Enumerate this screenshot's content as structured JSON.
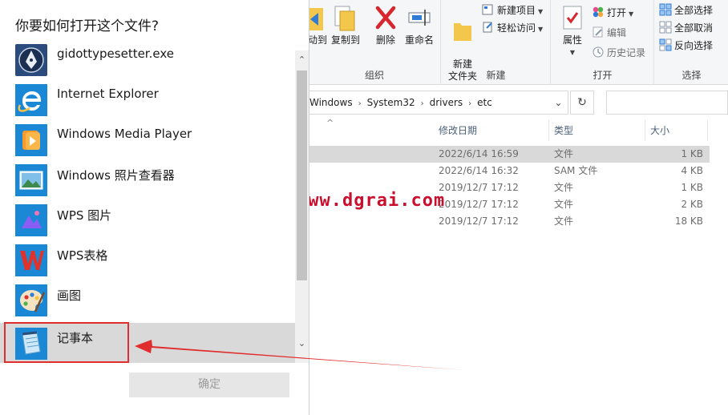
{
  "dialog": {
    "title": "你要如何打开这个文件?",
    "apps": [
      {
        "label": "gidottypesetter.exe",
        "icon": "pen-nib-icon"
      },
      {
        "label": "Internet Explorer",
        "icon": "internet-explorer-icon"
      },
      {
        "label": "Windows Media Player",
        "icon": "media-player-icon"
      },
      {
        "label": "Windows 照片查看器",
        "icon": "photo-viewer-icon"
      },
      {
        "label": "WPS 图片",
        "icon": "wps-picture-icon"
      },
      {
        "label": "WPS表格",
        "icon": "wps-spreadsheet-icon"
      },
      {
        "label": "画图",
        "icon": "paint-palette-icon"
      },
      {
        "label": "记事本",
        "icon": "notepad-icon"
      }
    ],
    "ok_label": "确定"
  },
  "ribbon": {
    "organize": {
      "move_label": "动到",
      "copy_label": "复制到",
      "delete_label": "删除",
      "rename_label": "重命名",
      "group_label": "组织"
    },
    "new": {
      "folder_label": "新建\n文件夹",
      "new_item_label": "新建项目",
      "easy_access_label": "轻松访问",
      "group_label": "新建"
    },
    "open": {
      "properties_label": "属性",
      "open_label": "打开",
      "edit_label": "编辑",
      "history_label": "历史记录",
      "group_label": "打开"
    },
    "select": {
      "select_all_label": "全部选择",
      "select_none_label": "全部取消",
      "invert_label": "反向选择",
      "group_label": "选择"
    }
  },
  "address": {
    "segments": [
      "Windows",
      "System32",
      "drivers",
      "etc"
    ]
  },
  "columns": {
    "date": "修改日期",
    "type": "类型",
    "size": "大小"
  },
  "files": [
    {
      "date": "2022/6/14 16:59",
      "type": "文件",
      "size": "1 KB",
      "selected": true
    },
    {
      "date": "2022/6/14 16:32",
      "type": "SAM 文件",
      "size": "4 KB",
      "selected": false
    },
    {
      "date": "2019/12/7 17:12",
      "type": "文件",
      "size": "1 KB",
      "selected": false
    },
    {
      "date": "2019/12/7 17:12",
      "type": "文件",
      "size": "2 KB",
      "selected": false
    },
    {
      "date": "2019/12/7 17:12",
      "type": "文件",
      "size": "18 KB",
      "selected": false
    }
  ],
  "watermark": "www.dgrai.com",
  "colors": {
    "annotation_red": "#e02d2d",
    "selection_gray": "#d9d9d9",
    "watermark_red": "#c8102e"
  }
}
